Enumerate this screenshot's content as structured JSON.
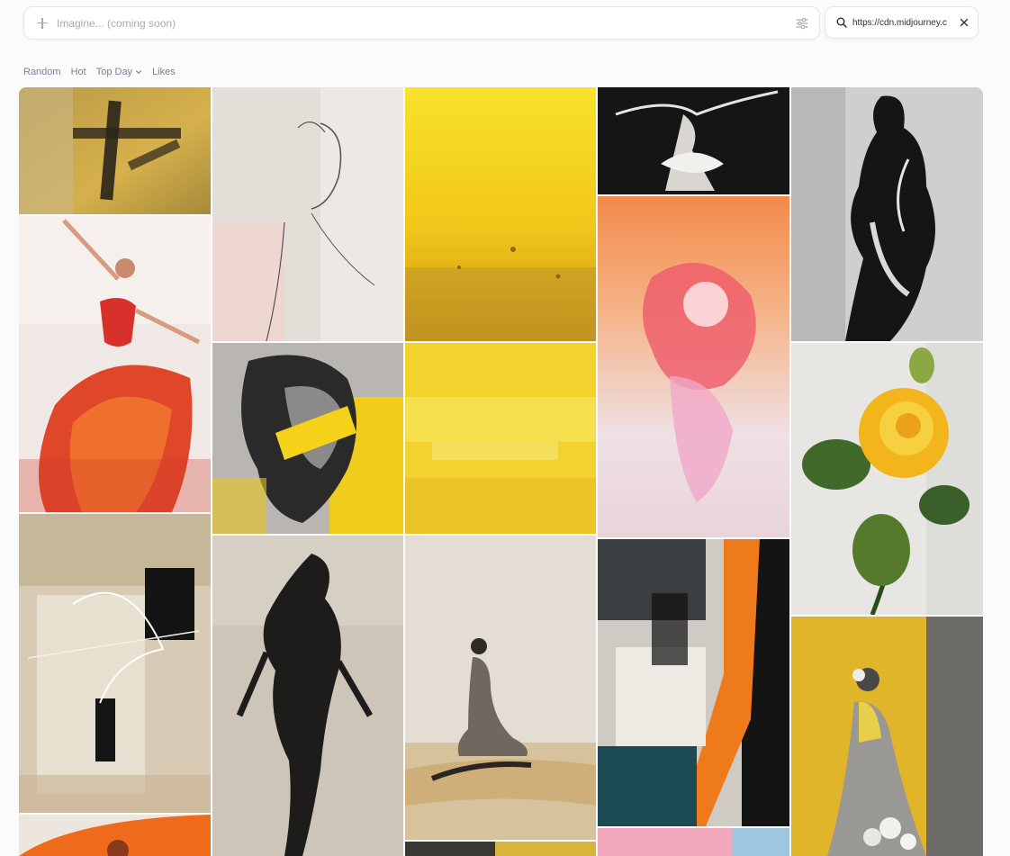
{
  "prompt_bar": {
    "placeholder": "Imagine... (coming soon)",
    "add_icon": "plus-icon",
    "settings_icon": "sliders-icon"
  },
  "search": {
    "value": "https://cdn.midjourney.c",
    "search_icon": "search-icon",
    "clear_icon": "close-icon"
  },
  "tabs": [
    {
      "label": "Random"
    },
    {
      "label": "Hot"
    },
    {
      "label": "Top Day"
    },
    {
      "label": "Likes"
    }
  ],
  "gallery": {
    "items": [
      {
        "subject": "abstract-yellow-black-cross"
      },
      {
        "subject": "dancer-red-dress"
      },
      {
        "subject": "abstract-beige-black-square"
      },
      {
        "subject": "orange-brush-partial"
      },
      {
        "subject": "woman-profile-sketch"
      },
      {
        "subject": "woman-face-black-yellow"
      },
      {
        "subject": "dark-figure-smoke"
      },
      {
        "subject": "yellow-gradient-abstract"
      },
      {
        "subject": "yellow-wash-abstract"
      },
      {
        "subject": "seated-figure-beige"
      },
      {
        "subject": "dark-yellow-partial"
      },
      {
        "subject": "ballerina-black-white"
      },
      {
        "subject": "orange-pink-explosion"
      },
      {
        "subject": "abstract-orange-teal-black"
      },
      {
        "subject": "pink-blue-partial"
      },
      {
        "subject": "black-figure-abstract"
      },
      {
        "subject": "yellow-rose"
      },
      {
        "subject": "woman-gray-dress-yellow"
      }
    ]
  },
  "colors": {
    "background": "#fbfbfb",
    "tab_text": "#7c7f96",
    "placeholder": "#a7aab5"
  }
}
